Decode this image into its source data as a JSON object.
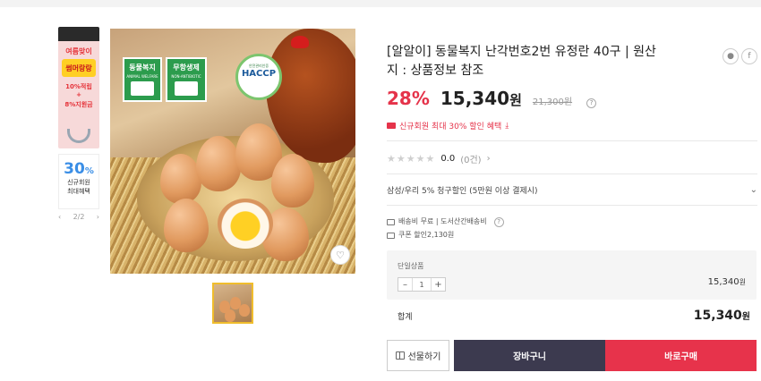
{
  "promo": {
    "top_title": "여름맞이",
    "top_badge": "썸머랑랑",
    "top_line1": "10%적립",
    "top_line2": "+",
    "top_line3": "8%지원금",
    "bottom_pct": "30",
    "bottom_pct_unit": "%",
    "bottom_line1": "신규회원",
    "bottom_line2": "최대혜택",
    "pager_text": "2/2",
    "prev_icon": "chevron-left-icon",
    "next_icon": "chevron-right-icon"
  },
  "image": {
    "badge1_title": "동물복지",
    "badge1_sub": "ANIMAL WELFARE",
    "badge2_title": "무항생제",
    "badge2_sub": "NON-ANTIBIOTIC",
    "haccp_top": "안전관리인증",
    "haccp_main": "HACCP",
    "wish_icon": "heart-icon"
  },
  "product": {
    "title": "[알알이] 동물복지 난각번호2번 유정란 40구 | 원산지 : 상품정보 참조",
    "discount": "28%",
    "price": "15,340",
    "price_unit": "원",
    "original_price": "21,300원",
    "coupon_text": "신규회원 최대 30% 할인 혜택",
    "rating_value": "0.0",
    "rating_count": "(0건)",
    "card_benefit": "삼성/우리 5% 청구할인 (5만원 이상 결제시)",
    "shipping_text": "배송비 무료 | 도서산간배송비",
    "coupon_discount": "쿠폰 할인2,130원"
  },
  "option": {
    "name": "단일상품",
    "quantity": "1",
    "price": "15,340",
    "price_unit": "원"
  },
  "total": {
    "label": "합계",
    "price": "15,340",
    "price_unit": "원"
  },
  "buttons": {
    "gift": "선물하기",
    "cart": "장바구니",
    "buy": "바로구매"
  },
  "colors": {
    "accent_red": "#e7334b",
    "cart_dark": "#3c3a4f",
    "promo_blue": "#3a8ee6"
  }
}
